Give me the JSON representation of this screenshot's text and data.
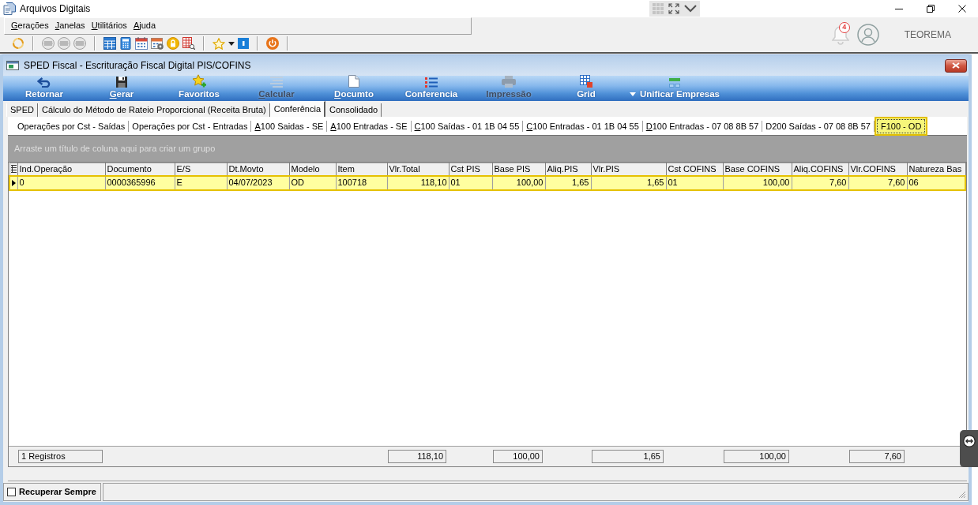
{
  "window": {
    "title": "Arquivos Digitais"
  },
  "menu": [
    {
      "label": "Gerações",
      "mnemonic": true
    },
    {
      "label": "Janelas",
      "mnemonic": true
    },
    {
      "label": "Utilitários",
      "mnemonic": true
    },
    {
      "label": "Ajuda",
      "mnemonic": true
    }
  ],
  "notifications": {
    "count": "4"
  },
  "user": {
    "name": "TEOREMA"
  },
  "document_window": {
    "title": "SPED Fiscal - Escrituração Fiscal Digital PIS/COFINS"
  },
  "actions": [
    {
      "label": "Retornar",
      "mnemonic": false,
      "disabled": false,
      "dropdown": false
    },
    {
      "label": "Gerar",
      "mnemonic": true,
      "disabled": false,
      "dropdown": false
    },
    {
      "label": "Favoritos",
      "mnemonic": false,
      "disabled": false,
      "dropdown": false
    },
    {
      "label": "Calcular",
      "mnemonic": true,
      "disabled": true,
      "dropdown": false
    },
    {
      "label": "Documto",
      "mnemonic": true,
      "disabled": false,
      "dropdown": false
    },
    {
      "label": "Conferencia",
      "mnemonic": false,
      "disabled": false,
      "dropdown": false
    },
    {
      "label": "Impressão",
      "mnemonic": false,
      "disabled": true,
      "dropdown": false
    },
    {
      "label": "Grid",
      "mnemonic": false,
      "disabled": false,
      "dropdown": false
    },
    {
      "label": "Unificar Empresas",
      "mnemonic": false,
      "disabled": false,
      "dropdown": true
    }
  ],
  "tabs": [
    {
      "label": "SPED",
      "selected": false
    },
    {
      "label": "Cálculo do Método de Rateio Proporcional (Receita Bruta)",
      "selected": false
    },
    {
      "label": "Conferência",
      "selected": true
    },
    {
      "label": "Consolidado",
      "selected": false
    }
  ],
  "subtabs": [
    {
      "label": "Operações por Cst - Saídas",
      "mnemonic": false,
      "selected": false
    },
    {
      "label": "Operações por Cst - Entradas",
      "mnemonic": false,
      "selected": false
    },
    {
      "label": "A100 Saidas - SE",
      "mnemonic": true,
      "selected": false
    },
    {
      "label": "A100 Entradas - SE",
      "mnemonic": true,
      "selected": false
    },
    {
      "label": "C100 Saídas - 01 1B 04 55",
      "mnemonic": true,
      "selected": false
    },
    {
      "label": "C100 Entradas - 01 1B 04 55",
      "mnemonic": true,
      "selected": false
    },
    {
      "label": "D100 Entradas - 07 08 8B 57",
      "mnemonic": true,
      "selected": false
    },
    {
      "label": "D200 Saídas - 07 08 8B 57",
      "mnemonic": false,
      "selected": false
    },
    {
      "label": "F100 - OD",
      "mnemonic": false,
      "selected": true
    }
  ],
  "group_panel": {
    "hint": "Arraste um título de coluna aqui para criar um grupo"
  },
  "table": {
    "columns": [
      {
        "label": "Ind.Operação",
        "numeric": false
      },
      {
        "label": "Documento",
        "numeric": false
      },
      {
        "label": "E/S",
        "numeric": false
      },
      {
        "label": "Dt.Movto",
        "numeric": false
      },
      {
        "label": "Modelo",
        "numeric": false
      },
      {
        "label": "Item",
        "numeric": false
      },
      {
        "label": "Vlr.Total",
        "numeric": true,
        "total": "118,10"
      },
      {
        "label": "Cst PIS",
        "numeric": false
      },
      {
        "label": "Base PIS",
        "numeric": true,
        "total": "100,00"
      },
      {
        "label": "Aliq.PIS",
        "numeric": true
      },
      {
        "label": "Vlr.PIS",
        "numeric": true,
        "total": "1,65"
      },
      {
        "label": "Cst COFINS",
        "numeric": false
      },
      {
        "label": "Base COFINS",
        "numeric": true,
        "total": "100,00"
      },
      {
        "label": "Aliq.COFINS",
        "numeric": true
      },
      {
        "label": "Vlr.COFINS",
        "numeric": true,
        "total": "7,60"
      },
      {
        "label": "Natureza Bas",
        "numeric": false
      }
    ],
    "rows": [
      {
        "selected": true,
        "cells": [
          "0",
          "0000365996",
          "E",
          "04/07/2023",
          "OD",
          "100718",
          "118,10",
          "01",
          "100,00",
          "1,65",
          "1,65",
          "01",
          "100,00",
          "7,60",
          "7,60",
          "06"
        ]
      }
    ],
    "record_count": "1 Registros"
  },
  "status_bar": {
    "checkbox": {
      "label": "Recuperar Sempre",
      "checked": false
    }
  }
}
